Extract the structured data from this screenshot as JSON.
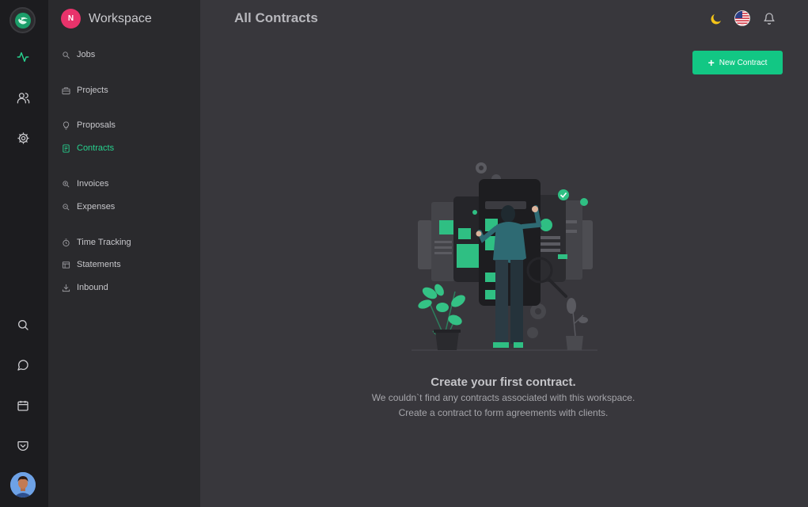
{
  "workspace": {
    "badge": "N",
    "name": "Workspace"
  },
  "rail": {
    "top_icons": [
      "activity-icon",
      "users-icon",
      "gear-icon"
    ],
    "bottom_icons": [
      "search-icon",
      "chat-icon",
      "calendar-icon",
      "pocket-icon"
    ]
  },
  "nav": {
    "jobs": "Jobs",
    "projects": "Projects",
    "proposals": "Proposals",
    "contracts": "Contracts",
    "invoices": "Invoices",
    "expenses": "Expenses",
    "time_tracking": "Time Tracking",
    "statements": "Statements",
    "inbound": "Inbound"
  },
  "header": {
    "title": "All Contracts",
    "icons": [
      "moon-icon",
      "us-flag-icon",
      "bell-icon"
    ]
  },
  "actions": {
    "new_contract": "New Contract"
  },
  "empty_state": {
    "title": "Create your first contract.",
    "line1": "We couldn`t find any contracts associated with this workspace.",
    "line2": "Create a contract to form agreements with clients."
  },
  "colors": {
    "accent": "#12c784",
    "active_nav": "#27d18e",
    "badge": "#e8336b",
    "moon": "#f5c518"
  }
}
